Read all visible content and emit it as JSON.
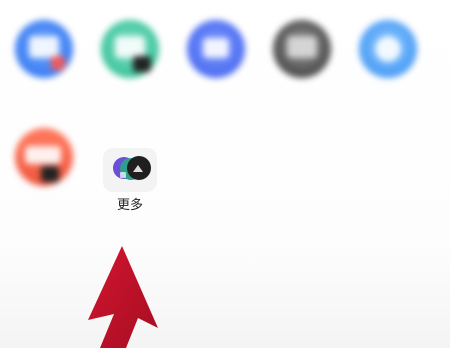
{
  "apps_row1": [
    {
      "label": "",
      "icon": "blue-app-icon"
    },
    {
      "label": "",
      "icon": "teal-app-icon"
    },
    {
      "label": "",
      "icon": "indigo-app-icon"
    },
    {
      "label": "",
      "icon": "gray-app-icon"
    },
    {
      "label": "",
      "icon": "sky-app-icon"
    }
  ],
  "apps_row2": [
    {
      "label": "",
      "icon": "orange-app-icon"
    }
  ],
  "more": {
    "label": "更多",
    "icon": "more-apps-icon"
  },
  "annotation": {
    "arrow_color": "#c8102e",
    "icon": "red-arrow-icon"
  }
}
